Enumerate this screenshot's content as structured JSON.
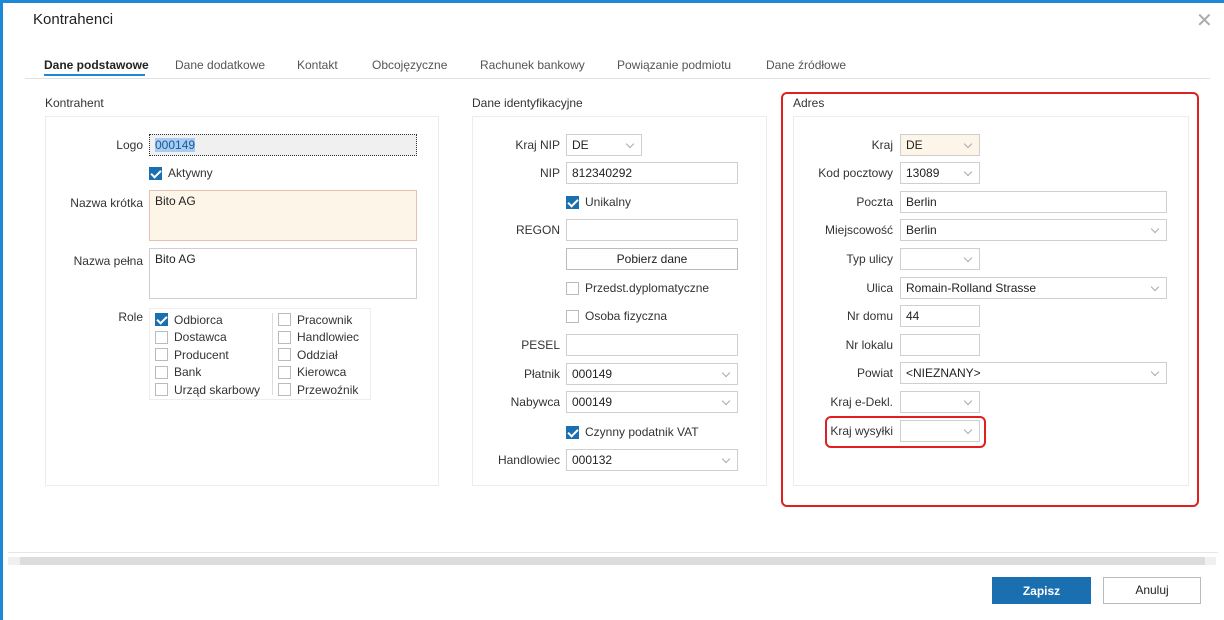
{
  "window": {
    "title": "Kontrahenci"
  },
  "tabs": [
    "Dane podstawowe",
    "Dane dodatkowe",
    "Kontakt",
    "Obcojęzyczne",
    "Rachunek bankowy",
    "Powiązanie podmiotu",
    "Dane źródłowe"
  ],
  "kontrahent": {
    "title": "Kontrahent",
    "logo_label": "Logo",
    "logo_value": "000149",
    "aktywny_label": "Aktywny",
    "nazwa_krotka_label": "Nazwa krótka",
    "nazwa_krotka_value": "Bito AG",
    "nazwa_pelna_label": "Nazwa pełna",
    "nazwa_pelna_value": "Bito AG",
    "role_label": "Role",
    "roles_left": [
      {
        "label": "Odbiorca",
        "checked": true
      },
      {
        "label": "Dostawca",
        "checked": false
      },
      {
        "label": "Producent",
        "checked": false
      },
      {
        "label": "Bank",
        "checked": false
      },
      {
        "label": "Urząd skarbowy",
        "checked": false
      }
    ],
    "roles_right": [
      {
        "label": "Pracownik",
        "checked": false
      },
      {
        "label": "Handlowiec",
        "checked": false
      },
      {
        "label": "Oddział",
        "checked": false
      },
      {
        "label": "Kierowca",
        "checked": false
      },
      {
        "label": "Przewoźnik",
        "checked": false
      }
    ]
  },
  "ident": {
    "title": "Dane identyfikacyjne",
    "kraj_nip_label": "Kraj NIP",
    "kraj_nip_value": "DE",
    "nip_label": "NIP",
    "nip_value": "812340292",
    "unikalny_label": "Unikalny",
    "regon_label": "REGON",
    "regon_value": "",
    "pobierz_label": "Pobierz dane",
    "przedst_label": "Przedst.dyplomatyczne",
    "osoba_label": "Osoba fizyczna",
    "pesel_label": "PESEL",
    "pesel_value": "",
    "platnik_label": "Płatnik",
    "platnik_value": "000149",
    "nabywca_label": "Nabywca",
    "nabywca_value": "000149",
    "czynny_label": "Czynny podatnik VAT",
    "handlowiec_label": "Handlowiec",
    "handlowiec_value": "000132"
  },
  "adres": {
    "title": "Adres",
    "kraj_label": "Kraj",
    "kraj_value": "DE",
    "kod_label": "Kod pocztowy",
    "kod_value": "13089",
    "poczta_label": "Poczta",
    "poczta_value": "Berlin",
    "miejscowosc_label": "Miejscowość",
    "miejscowosc_value": "Berlin",
    "typ_ulicy_label": "Typ ulicy",
    "typ_ulicy_value": "",
    "ulica_label": "Ulica",
    "ulica_value": "Romain-Rolland Strasse",
    "nr_domu_label": "Nr domu",
    "nr_domu_value": "44",
    "nr_lokalu_label": "Nr lokalu",
    "nr_lokalu_value": "",
    "powiat_label": "Powiat",
    "powiat_value": "<NIEZNANY>",
    "kraj_edekl_label": "Kraj e-Dekl.",
    "kraj_edekl_value": "",
    "kraj_wysylki_label": "Kraj wysyłki",
    "kraj_wysylki_value": ""
  },
  "footer": {
    "save_label": "Zapisz",
    "cancel_label": "Anuluj"
  },
  "colors": {
    "accent": "#1a6fb0",
    "highlight": "#e02020",
    "required_bg": "#fdf5e8"
  }
}
